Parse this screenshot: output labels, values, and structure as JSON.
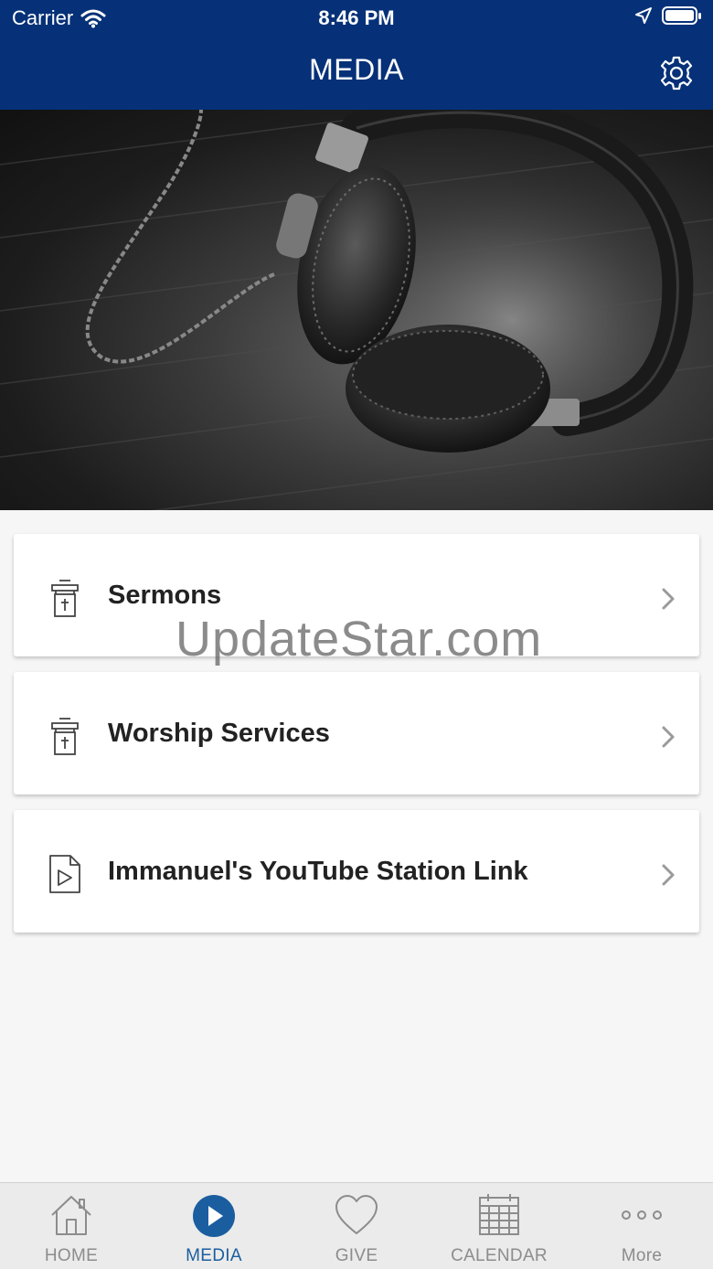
{
  "status_bar": {
    "carrier": "Carrier",
    "time": "8:46 PM"
  },
  "header": {
    "title": "MEDIA"
  },
  "hero": {
    "image": "headphones-photo"
  },
  "menu": {
    "items": [
      {
        "label": "Sermons",
        "icon": "pulpit-icon"
      },
      {
        "label": "Worship Services",
        "icon": "pulpit-icon"
      },
      {
        "label": "Immanuel's YouTube Station Link",
        "icon": "video-file-icon"
      }
    ]
  },
  "watermark": "UpdateStar.com",
  "tabs": [
    {
      "label": "HOME",
      "icon": "home-icon"
    },
    {
      "label": "MEDIA",
      "icon": "play-icon",
      "active": true
    },
    {
      "label": "GIVE",
      "icon": "heart-icon"
    },
    {
      "label": "CALENDAR",
      "icon": "calendar-icon"
    },
    {
      "label": "More",
      "icon": "more-icon"
    }
  ],
  "colors": {
    "header_bg": "#063178",
    "active_tab": "#1b5e9f",
    "background": "#f6f6f6"
  }
}
